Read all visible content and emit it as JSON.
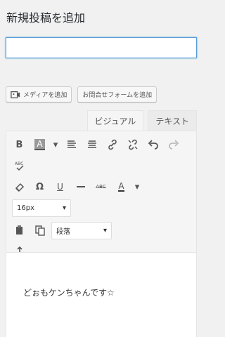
{
  "page": {
    "title": "新規投稿を追加"
  },
  "title_input": {
    "value": ""
  },
  "buttons": {
    "add_media": "メディアを追加",
    "add_contact_form": "お問合せフォームを追加"
  },
  "tabs": [
    {
      "label": "ビジュアル",
      "active": true
    },
    {
      "label": "テキスト",
      "active": false
    }
  ],
  "toolbar": {
    "font_size": "16px",
    "format": "段落"
  },
  "content": {
    "text": "どぉもケンちゃんです☆"
  },
  "colors": {
    "focus_border": "#5b9dd9",
    "background": "#f1f1f1"
  }
}
